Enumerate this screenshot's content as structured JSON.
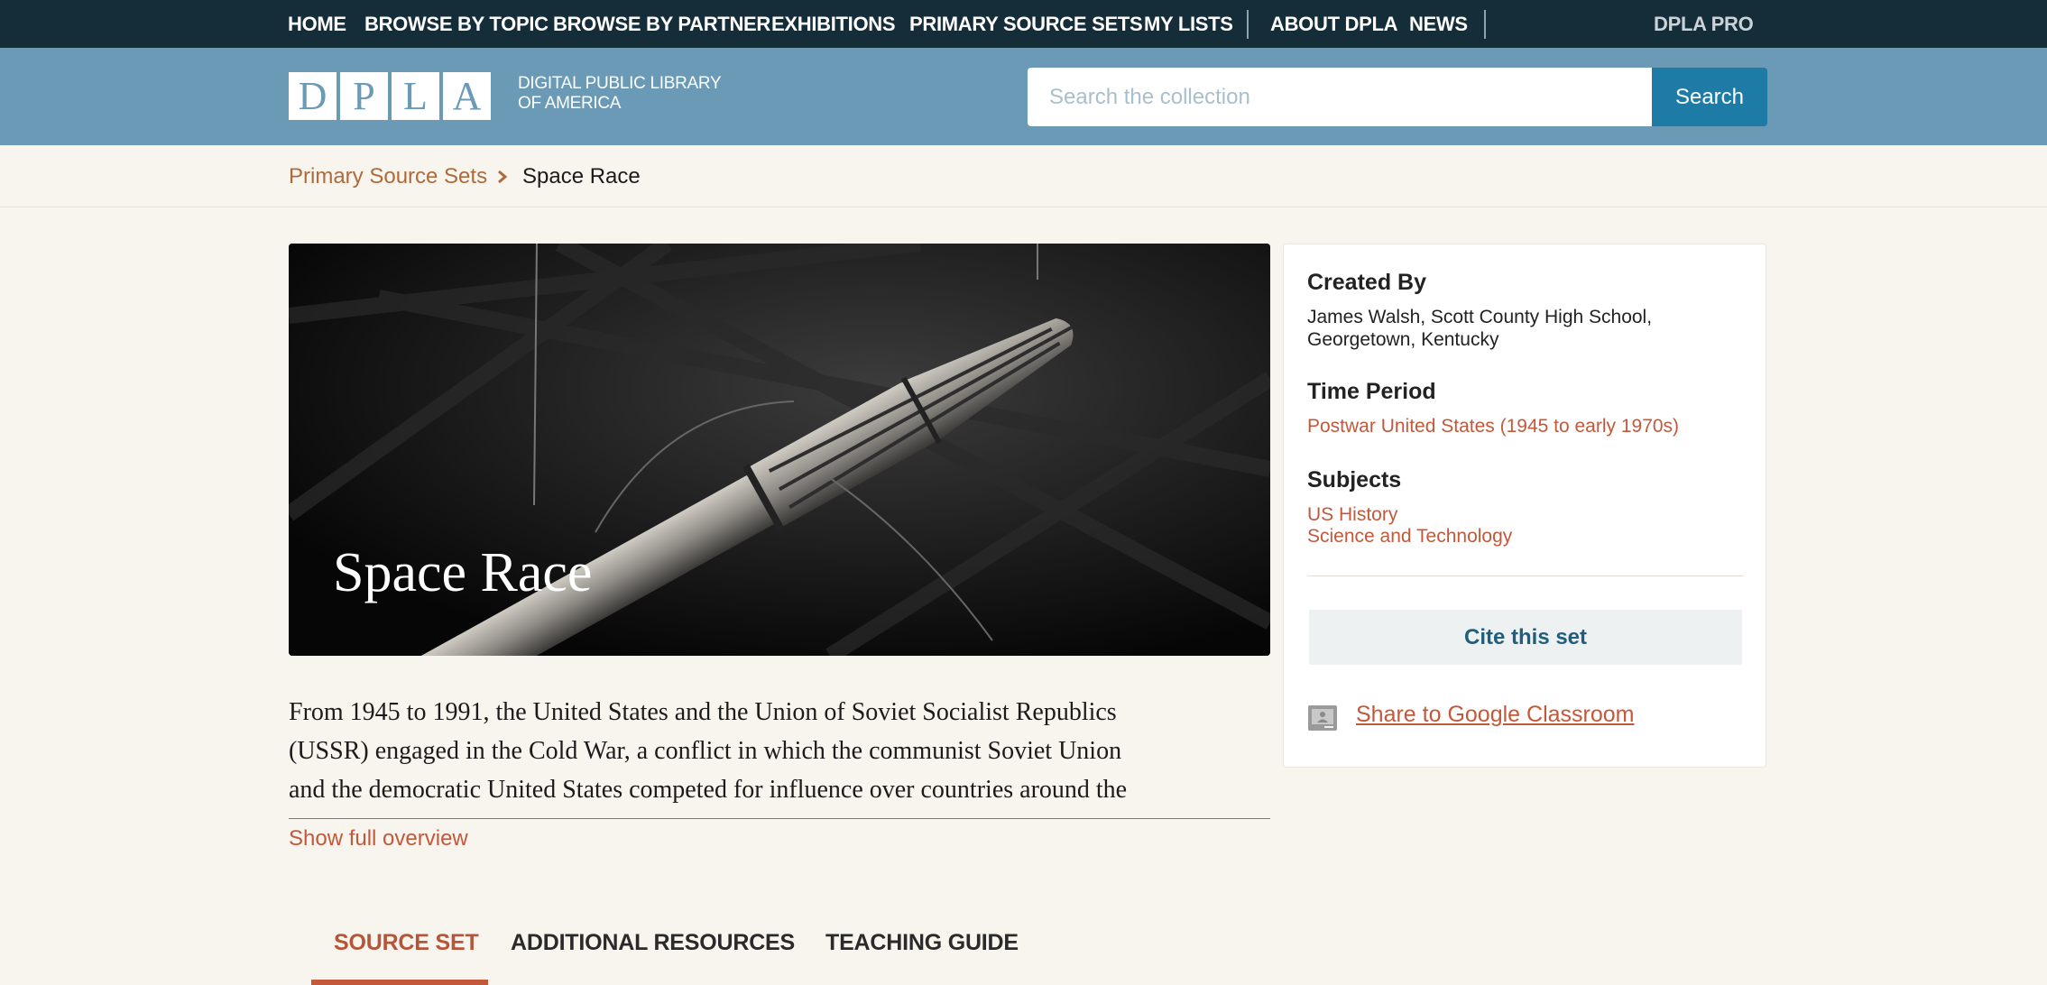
{
  "top_nav": {
    "items": [
      "HOME",
      "BROWSE BY TOPIC",
      "BROWSE BY PARTNER",
      "EXHIBITIONS",
      "PRIMARY SOURCE SETS",
      "MY LISTS",
      "ABOUT DPLA",
      "NEWS"
    ],
    "pro_label": "DPLA PRO"
  },
  "header": {
    "logo_letters": [
      "D",
      "P",
      "L",
      "A"
    ],
    "logo_text_line1": "Digital Public Library",
    "logo_text_line2": "of America",
    "search_placeholder": "Search the collection",
    "search_button": "Search"
  },
  "breadcrumb": {
    "parent": "Primary Source Sets",
    "current": "Space Race"
  },
  "hero": {
    "title": "Space Race"
  },
  "sidebar": {
    "created_by_heading": "Created By",
    "created_by_line1": "James Walsh, Scott County High School,",
    "created_by_line2": "Georgetown, Kentucky",
    "time_period_heading": "Time Period",
    "time_period_link": "Postwar United States (1945 to early 1970s)",
    "subjects_heading": "Subjects",
    "subjects": [
      "US History",
      "Science and Technology"
    ],
    "cite_button": "Cite this set",
    "share_link": "Share to Google Classroom"
  },
  "overview": {
    "lines": [
      "From 1945 to 1991, the United States and the Union of Soviet Socialist Republics",
      "(USSR) engaged in the Cold War, a conflict in which the communist Soviet Union",
      "and the democratic United States competed for influence over countries around the"
    ],
    "show_full": "Show full overview"
  },
  "tabs": [
    {
      "label": "SOURCE SET",
      "active": true
    },
    {
      "label": "ADDITIONAL RESOURCES",
      "active": false
    },
    {
      "label": "TEACHING GUIDE",
      "active": false
    }
  ],
  "colors": {
    "nav_bg": "#152c39",
    "header_bg": "#6a9ab5",
    "search_button_bg": "#1d7ba6",
    "link": "#c4583a",
    "page_bg": "#f8f5ef"
  }
}
